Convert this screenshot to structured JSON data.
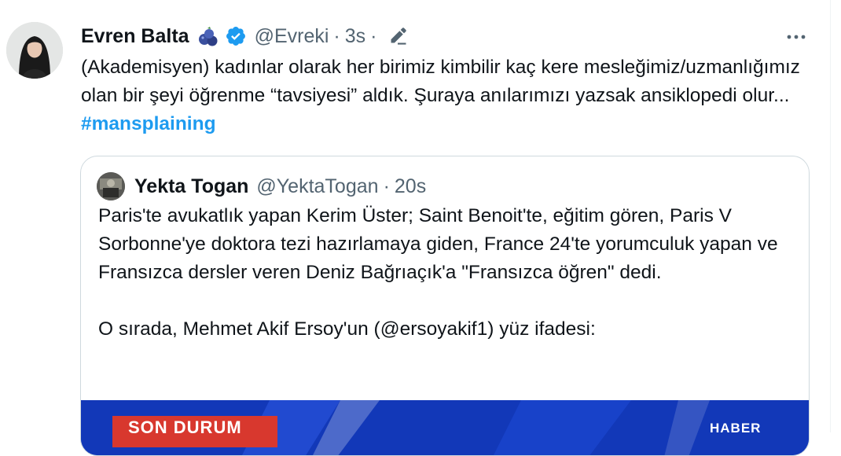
{
  "tweet": {
    "display_name": "Evren Balta",
    "emoji_icon": "blueberries-icon",
    "verified_icon": "verified-badge-icon",
    "handle": "@Evreki",
    "separator": "·",
    "time": "3s",
    "edit_separator": "·",
    "edit_icon": "pencil-icon",
    "more_icon": "more-dots-icon",
    "text": "(Akademisyen) kadınlar olarak her birimiz kimbilir kaç kere mesleğimiz/uzmanlığımız olan bir şeyi öğrenme “tavsiyesi” aldık. Şuraya anılarımızı yazsak ansiklopedi olur...",
    "hashtag": "#mansplaining"
  },
  "quoted": {
    "display_name": "Yekta Togan",
    "handle": "@YektaTogan",
    "separator": "·",
    "time": "20s",
    "paragraph1": "Paris'te avukatlık yapan Kerim Üster; Saint Benoit'te, eğitim gören, Paris V Sorbonne'ye doktora tezi hazırlamaya giden, France 24'te yorumculuk yapan ve Fransızca dersler veren Deniz Bağrıaçık'a \"Fransızca öğren\" dedi.",
    "paragraph2": "O sırada, Mehmet Akif Ersoy'un (@ersoyakif1) yüz ifadesi:",
    "media": {
      "banner_left": "SON DURUM",
      "banner_right": "HABER"
    }
  },
  "colors": {
    "accent": "#1d9bf0",
    "muted": "#536471",
    "border": "#cfd9de",
    "media_blue": "#1238b8",
    "banner_red": "#d8382e"
  }
}
